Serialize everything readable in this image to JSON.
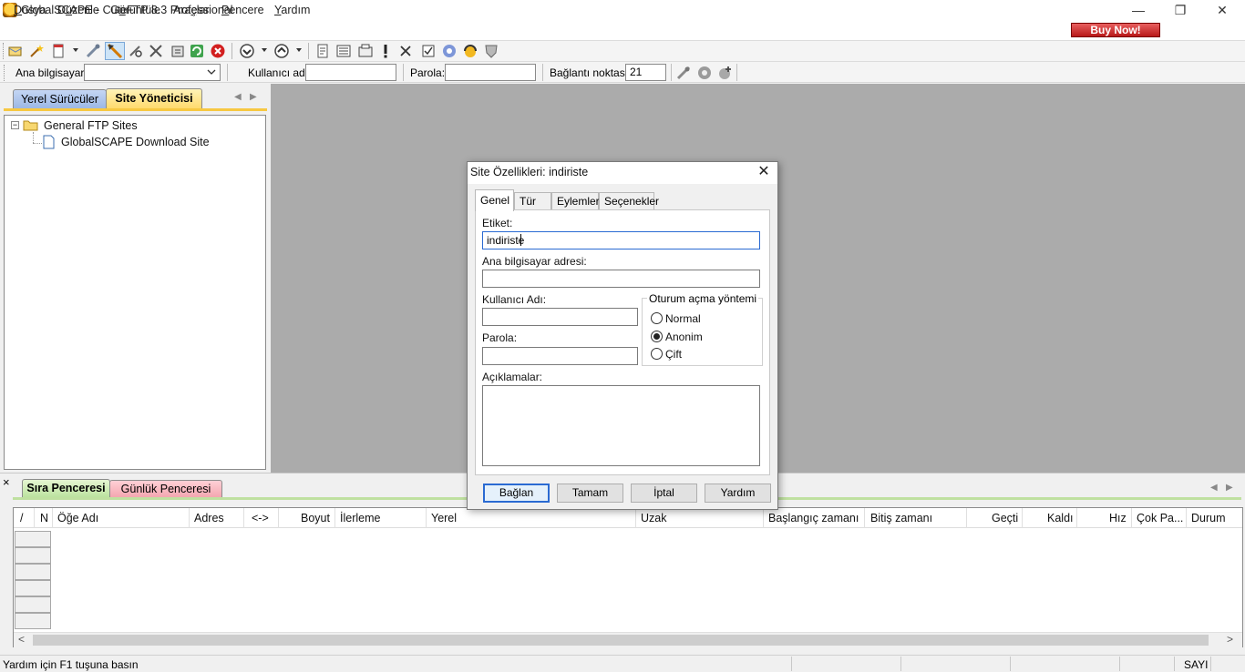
{
  "window": {
    "title": "GlobalSCAPE - CuteFTP 8.3 Professional",
    "controls": {
      "minimize": "—",
      "restore": "❐",
      "close": "✕"
    }
  },
  "menu": {
    "items": [
      {
        "pre": "",
        "u": "D",
        "post": "osya"
      },
      {
        "pre": "D",
        "u": "ü",
        "post": "zenle"
      },
      {
        "pre": "G",
        "u": "ö",
        "post": "rüntüle"
      },
      {
        "pre": "Ara",
        "u": "ç",
        "post": "lar"
      },
      {
        "pre": "",
        "u": "P",
        "post": "encere"
      },
      {
        "pre": "",
        "u": "Y",
        "post": "ardım"
      }
    ],
    "buy_now": "Buy Now!"
  },
  "quick_connect": {
    "host_label": "Ana bilgisayar:",
    "host_value": "",
    "user_label": "Kullanıcı adı:",
    "user_value": "",
    "pass_label": "Parola:",
    "pass_value": "",
    "port_label": "Bağlantı noktası:",
    "port_value": "21"
  },
  "left_panel": {
    "tabs": [
      "Yerel Sürücüler",
      "Site Yöneticisi"
    ],
    "nav": {
      "prev": "◀",
      "next": "▶"
    },
    "tree": {
      "root": "General FTP Sites",
      "child": "GlobalSCAPE Download Site",
      "collapse_glyph": "−"
    }
  },
  "dialog": {
    "title": "Site Özellikleri: indiriste",
    "close": "✕",
    "tabs": [
      "Genel",
      "Tür",
      "Eylemler",
      "Seçenekler"
    ],
    "label_label": "Etiket:",
    "label_value": "indiriste",
    "host_label": "Ana bilgisayar adresi:",
    "host_value": "",
    "user_label": "Kullanıcı Adı:",
    "user_value": "",
    "pass_label": "Parola:",
    "pass_value": "",
    "notes_label": "Açıklamalar:",
    "notes_value": "",
    "login_group": "Oturum açma yöntemi",
    "login_options": [
      "Normal",
      "Anonim",
      "Çift"
    ],
    "login_selected": "Anonim",
    "buttons": [
      "Bağlan",
      "Tamam",
      "İptal",
      "Yardım"
    ]
  },
  "bottom_panel": {
    "close": "×",
    "tabs": [
      "Sıra Penceresi",
      "Günlük Penceresi"
    ],
    "nav": {
      "prev": "◀",
      "next": "▶"
    },
    "columns": [
      "/",
      "N",
      "Öğe Adı",
      "Adres",
      "<->",
      "Boyut",
      "İlerleme",
      "Yerel",
      "Uzak",
      "Başlangıç zamanı",
      "Bitiş zamanı",
      "Geçti",
      "Kaldı",
      "Hız",
      "Çok Pa...",
      "Durum"
    ],
    "scroll": {
      "left": "<",
      "right": ">"
    }
  },
  "status_bar": {
    "text": "Yardım için F1 tuşuna basın",
    "num": "SAYI"
  }
}
